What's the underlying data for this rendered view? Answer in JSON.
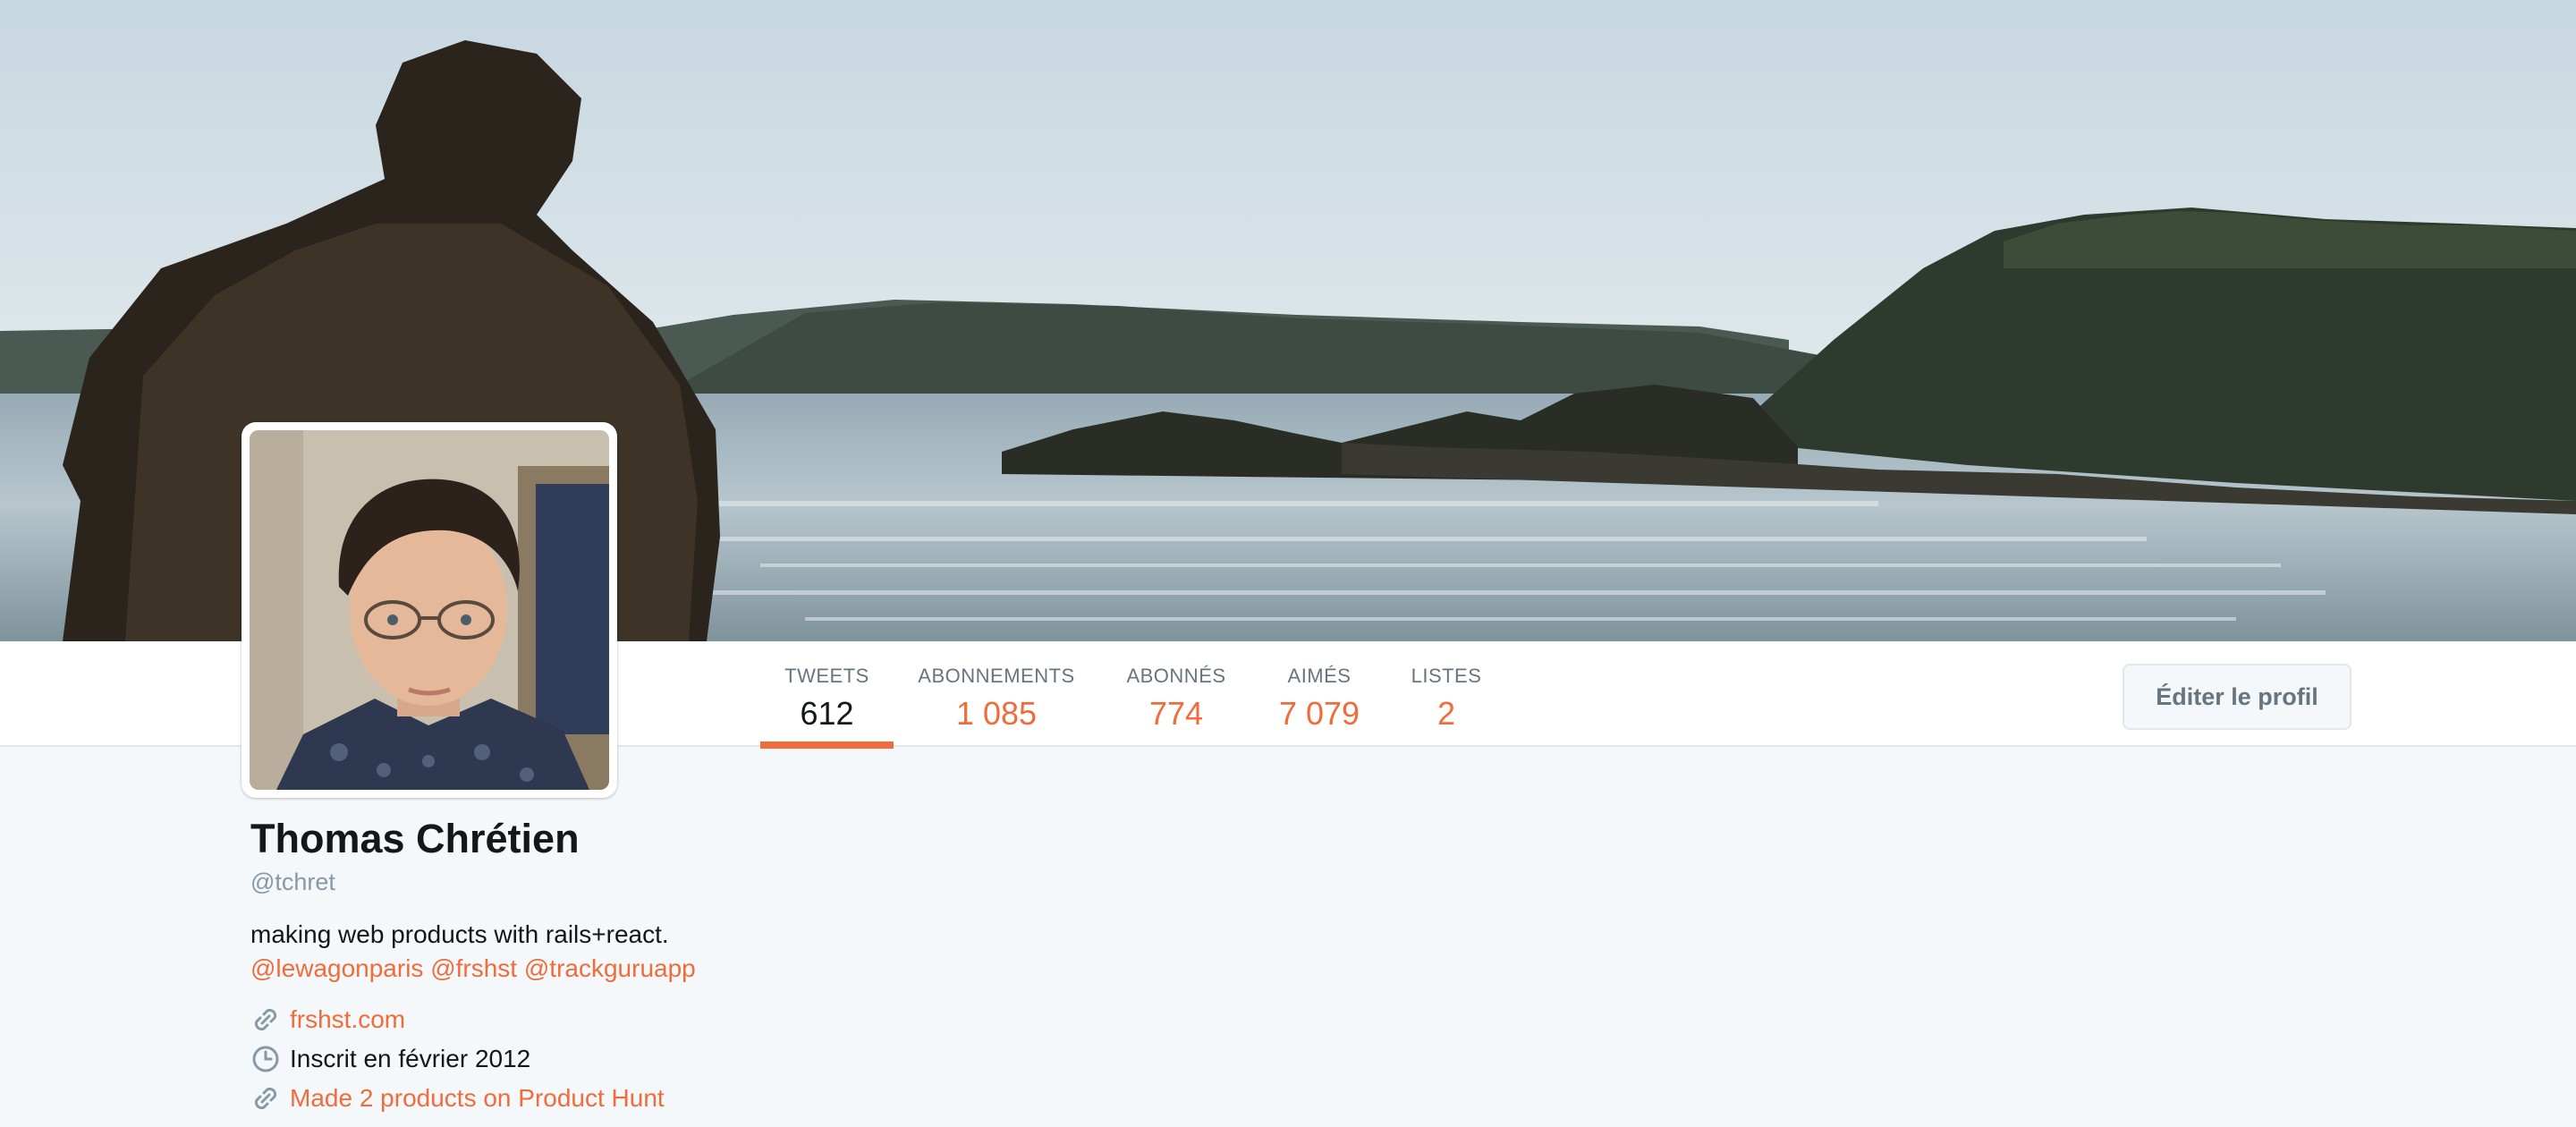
{
  "header": {
    "banner_alt": "",
    "avatar_alt": ""
  },
  "nav": {
    "stats": [
      {
        "label": "TWEETS",
        "value": "612",
        "active": true
      },
      {
        "label": "ABONNEMENTS",
        "value": "1 085",
        "active": false
      },
      {
        "label": "ABONNÉS",
        "value": "774",
        "active": false
      },
      {
        "label": "AIMÉS",
        "value": "7 079",
        "active": false
      },
      {
        "label": "LISTES",
        "value": "2",
        "active": false
      }
    ],
    "edit_profile_label": "Éditer le profil"
  },
  "profile": {
    "name": "Thomas Chrétien",
    "handle": "@tchret",
    "bio": "making web products with rails+react.",
    "mentions": [
      "@lewagonparis",
      "@frshst",
      "@trackguruapp"
    ],
    "website": {
      "icon": "link-icon",
      "text": "frshst.com"
    },
    "joined": {
      "icon": "clock-icon",
      "text": "Inscrit en février 2012"
    },
    "extra_link": {
      "icon": "link-icon",
      "text": "Made 2 products on Product Hunt"
    }
  },
  "colors": {
    "accent": "#f26b3a",
    "text": "#14171a",
    "muted": "#66757f",
    "page_bg": "#f5f8fa"
  }
}
